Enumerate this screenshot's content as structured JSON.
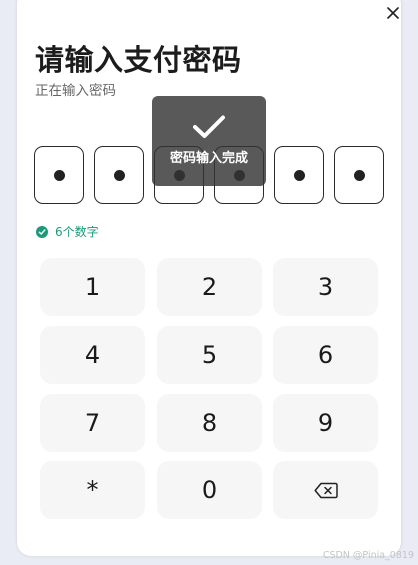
{
  "dialog": {
    "title": "请输入支付密码",
    "subtitle": "正在输入密码",
    "close_icon": "close-icon"
  },
  "pin": {
    "length": 6,
    "filled": 6
  },
  "hint": {
    "text": "6个数字",
    "icon": "check-circle-icon",
    "color": "#1a9a78"
  },
  "keypad": {
    "keys": [
      "1",
      "2",
      "3",
      "4",
      "5",
      "6",
      "7",
      "8",
      "9",
      "*",
      "0"
    ],
    "backspace_icon": "backspace-icon"
  },
  "toast": {
    "text": "密码输入完成",
    "icon": "checkmark-icon"
  },
  "watermark": "CSDN @Pinia_0819"
}
